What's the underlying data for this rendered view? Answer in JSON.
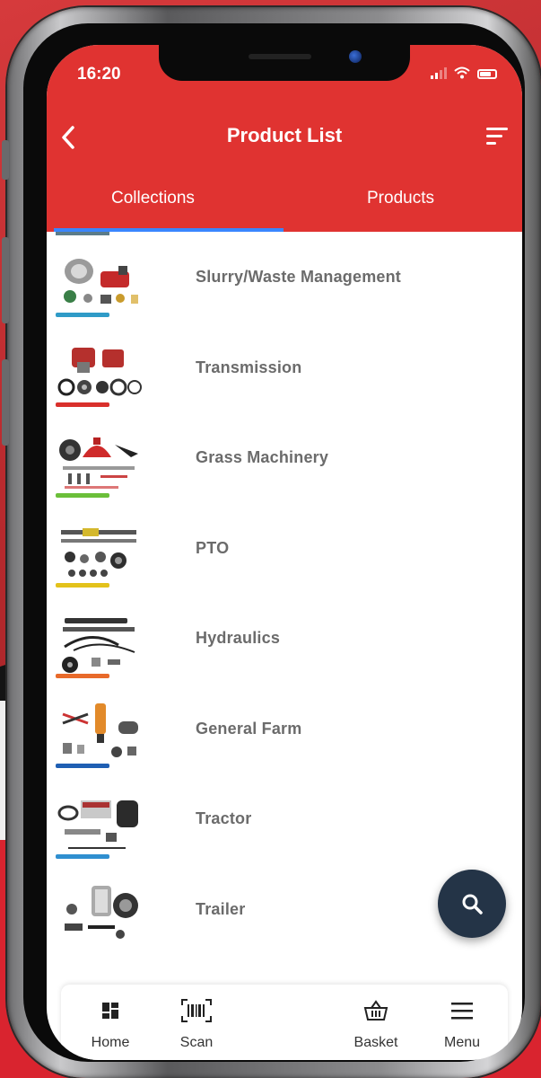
{
  "status_bar": {
    "time": "16:20"
  },
  "header": {
    "title": "Product List"
  },
  "tabs": [
    {
      "label": "Collections",
      "active": true
    },
    {
      "label": "Products",
      "active": false
    }
  ],
  "collections": [
    {
      "label": "Slurry/Waste Management",
      "accent": "#2f9bc7"
    },
    {
      "label": "Transmission",
      "accent": "#d9302c"
    },
    {
      "label": "Grass Machinery",
      "accent": "#6bbf3a"
    },
    {
      "label": "PTO",
      "accent": "#e3c21b"
    },
    {
      "label": "Hydraulics",
      "accent": "#e86a2a"
    },
    {
      "label": "General Farm",
      "accent": "#1f5fb3"
    },
    {
      "label": "Tractor",
      "accent": "#2f8fd0"
    },
    {
      "label": "Trailer",
      "accent": "#d9302c"
    }
  ],
  "fab": {
    "icon": "search-icon"
  },
  "bottom_nav": [
    {
      "label": "Home",
      "icon": "home-icon"
    },
    {
      "label": "Scan",
      "icon": "barcode-icon"
    },
    {
      "label": "Basket",
      "icon": "basket-icon"
    },
    {
      "label": "Menu",
      "icon": "menu-icon"
    }
  ],
  "colors": {
    "primary": "#e03331",
    "fab": "#243447",
    "tab_indicator": "#3a86ff"
  }
}
